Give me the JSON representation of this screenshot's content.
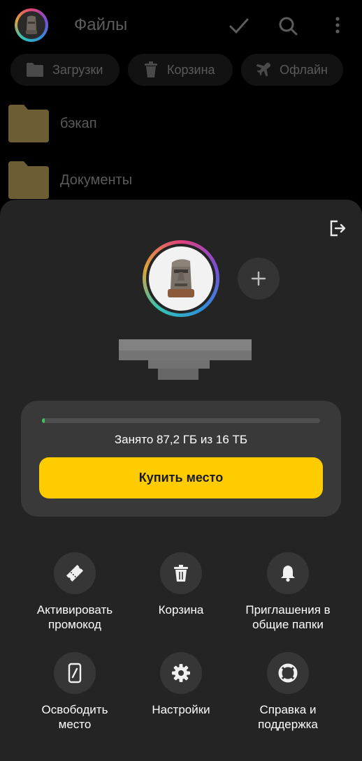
{
  "header": {
    "title": "Файлы"
  },
  "chips": [
    {
      "label": "Загрузки",
      "icon": "folder-icon"
    },
    {
      "label": "Корзина",
      "icon": "trash-icon"
    },
    {
      "label": "Офлайн",
      "icon": "airplane-icon"
    }
  ],
  "folders": [
    {
      "name": "бэкап"
    },
    {
      "name": "Документы"
    }
  ],
  "storage": {
    "used_text": "Занято 87,2 ГБ из 16 ТБ",
    "used_fraction": 0.0054,
    "buy_label": "Купить место"
  },
  "actions": [
    {
      "label": "Активировать\nпромокод",
      "icon": "promocode-icon"
    },
    {
      "label": "Корзина",
      "icon": "trash-icon"
    },
    {
      "label": "Приглашения в\nобщие папки",
      "icon": "bell-icon"
    },
    {
      "label": "Освободить\nместо",
      "icon": "phone-icon"
    },
    {
      "label": "Настройки",
      "icon": "gear-icon"
    },
    {
      "label": "Справка и\nподдержка",
      "icon": "lifebuoy-icon"
    }
  ],
  "colors": {
    "accent": "#fecc00",
    "progress": "#3cc65c",
    "sheet": "#242424"
  }
}
